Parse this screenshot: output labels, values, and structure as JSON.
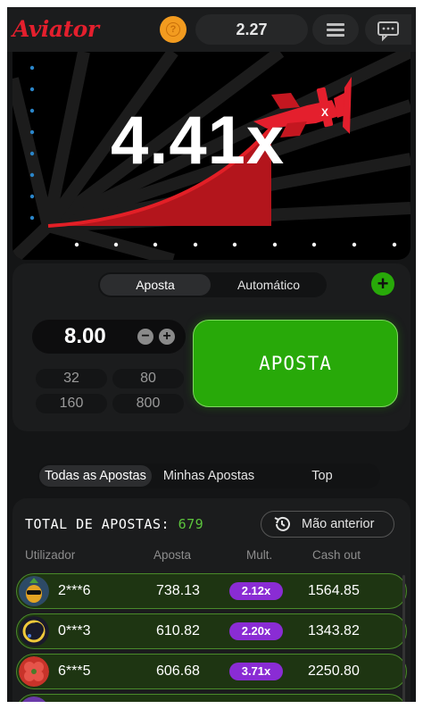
{
  "header": {
    "logo": "Aviator",
    "balance": "2.27",
    "coin_icon": "coin-icon",
    "menu_icon": "hamburger-menu-icon",
    "chat_icon": "chat-bubble-icon"
  },
  "game": {
    "multiplier": "4.41x",
    "curve_color": "#d81f26",
    "plane_color": "#e41f2d"
  },
  "bet_panel": {
    "mode_tabs": [
      "Aposta",
      "Automático"
    ],
    "active_mode": "Aposta",
    "amount": "8.00",
    "quick_amounts": [
      "32",
      "80",
      "160",
      "800"
    ],
    "bet_button": "APOSTA",
    "accent": "#28a909"
  },
  "bets_tabs": {
    "items": [
      "Todas as Apostas",
      "Minhas Apostas",
      "Top"
    ],
    "active": "Todas as Apostas"
  },
  "bets_list": {
    "total_label": "TOTAL DE APOSTAS:",
    "total_count": "679",
    "previous_button": "Mão anterior",
    "columns": [
      "Utilizador",
      "Aposta",
      "Mult.",
      "Cash out"
    ],
    "rows": [
      {
        "user": "2***6",
        "bet": "738.13",
        "mult": "2.12x",
        "cashout": "1564.85"
      },
      {
        "user": "0***3",
        "bet": "610.82",
        "mult": "2.20x",
        "cashout": "1343.82"
      },
      {
        "user": "6***5",
        "bet": "606.68",
        "mult": "3.71x",
        "cashout": "2250.80"
      }
    ],
    "mult_color": "#8a2cd4"
  }
}
